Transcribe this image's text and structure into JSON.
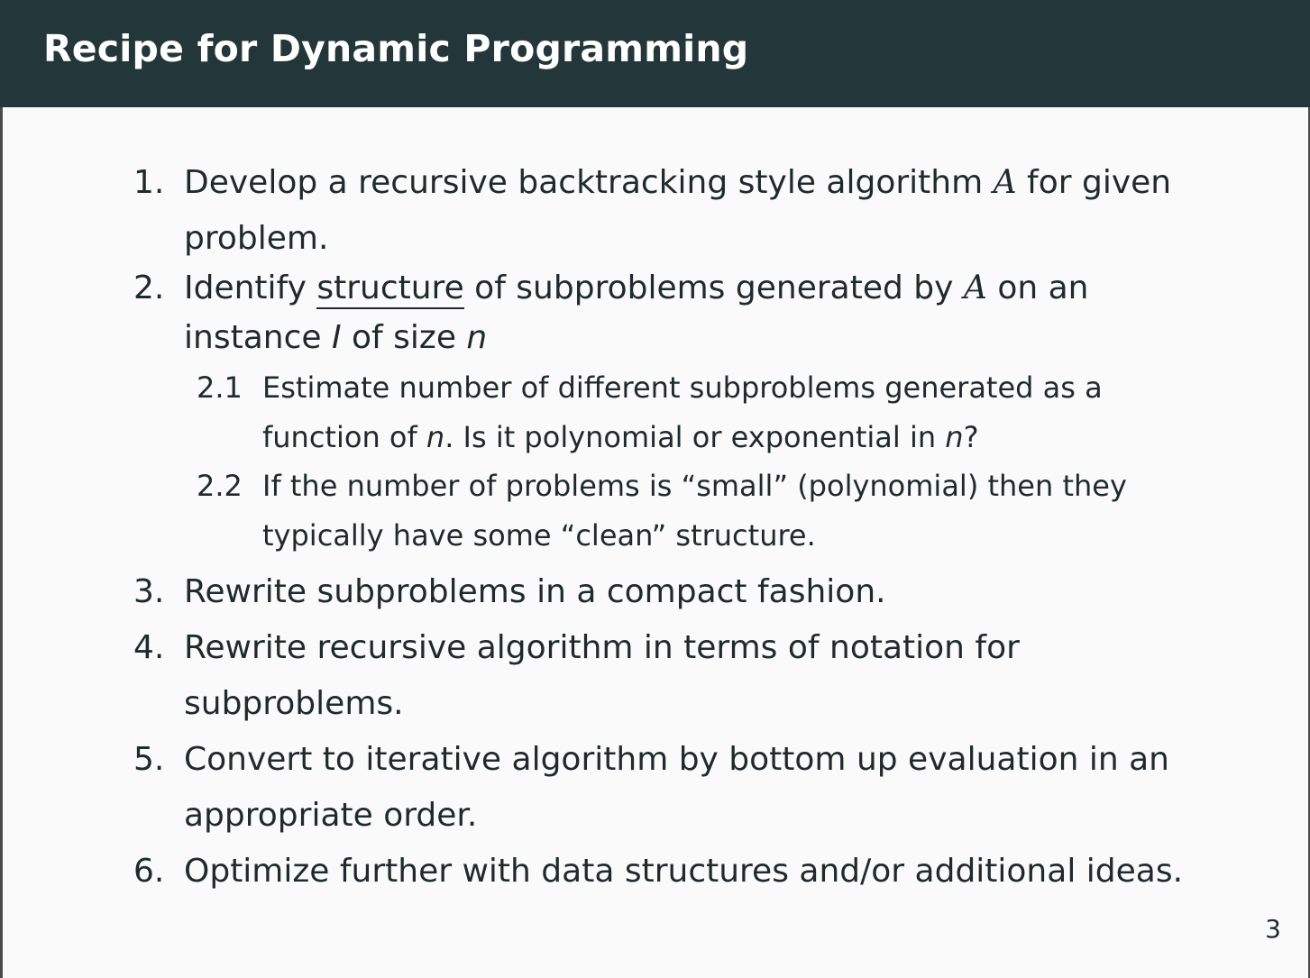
{
  "slide": {
    "title": "Recipe for Dynamic Programming",
    "page_number": "3"
  },
  "items": [
    {
      "number": "1.",
      "line1_a": "Develop a recursive backtracking style algorithm ",
      "line1_sym": "A",
      "line1_b": " for given",
      "line2": "problem."
    },
    {
      "number": "2.",
      "line1_a": "Identify ",
      "line1_ul": "structure",
      "line1_b": " of subproblems generated by ",
      "line1_sym": "A",
      "line1_c": " on an",
      "line2_a": "instance ",
      "line2_var1": "I",
      "line2_b": " of size ",
      "line2_var2": "n"
    },
    {
      "number": "3.",
      "line1": "Rewrite subproblems in a compact fashion."
    },
    {
      "number": "4.",
      "line1": "Rewrite recursive algorithm in terms of notation for",
      "line2": "subproblems."
    },
    {
      "number": "5.",
      "line1": "Convert to iterative algorithm by bottom up evaluation in an",
      "line2": "appropriate order."
    },
    {
      "number": "6.",
      "line1": "Optimize further with data structures and/or additional ideas."
    }
  ],
  "subitems": [
    {
      "number": "2.1",
      "line1": "Estimate number of different subproblems generated as a",
      "line2_a": "function of ",
      "line2_var1": "n",
      "line2_b": ". Is it polynomial or exponential in ",
      "line2_var2": "n",
      "line2_c": "?"
    },
    {
      "number": "2.2",
      "line1": "If the number of problems is “small” (polynomial) then they",
      "line2": "typically have some “clean” structure."
    }
  ]
}
